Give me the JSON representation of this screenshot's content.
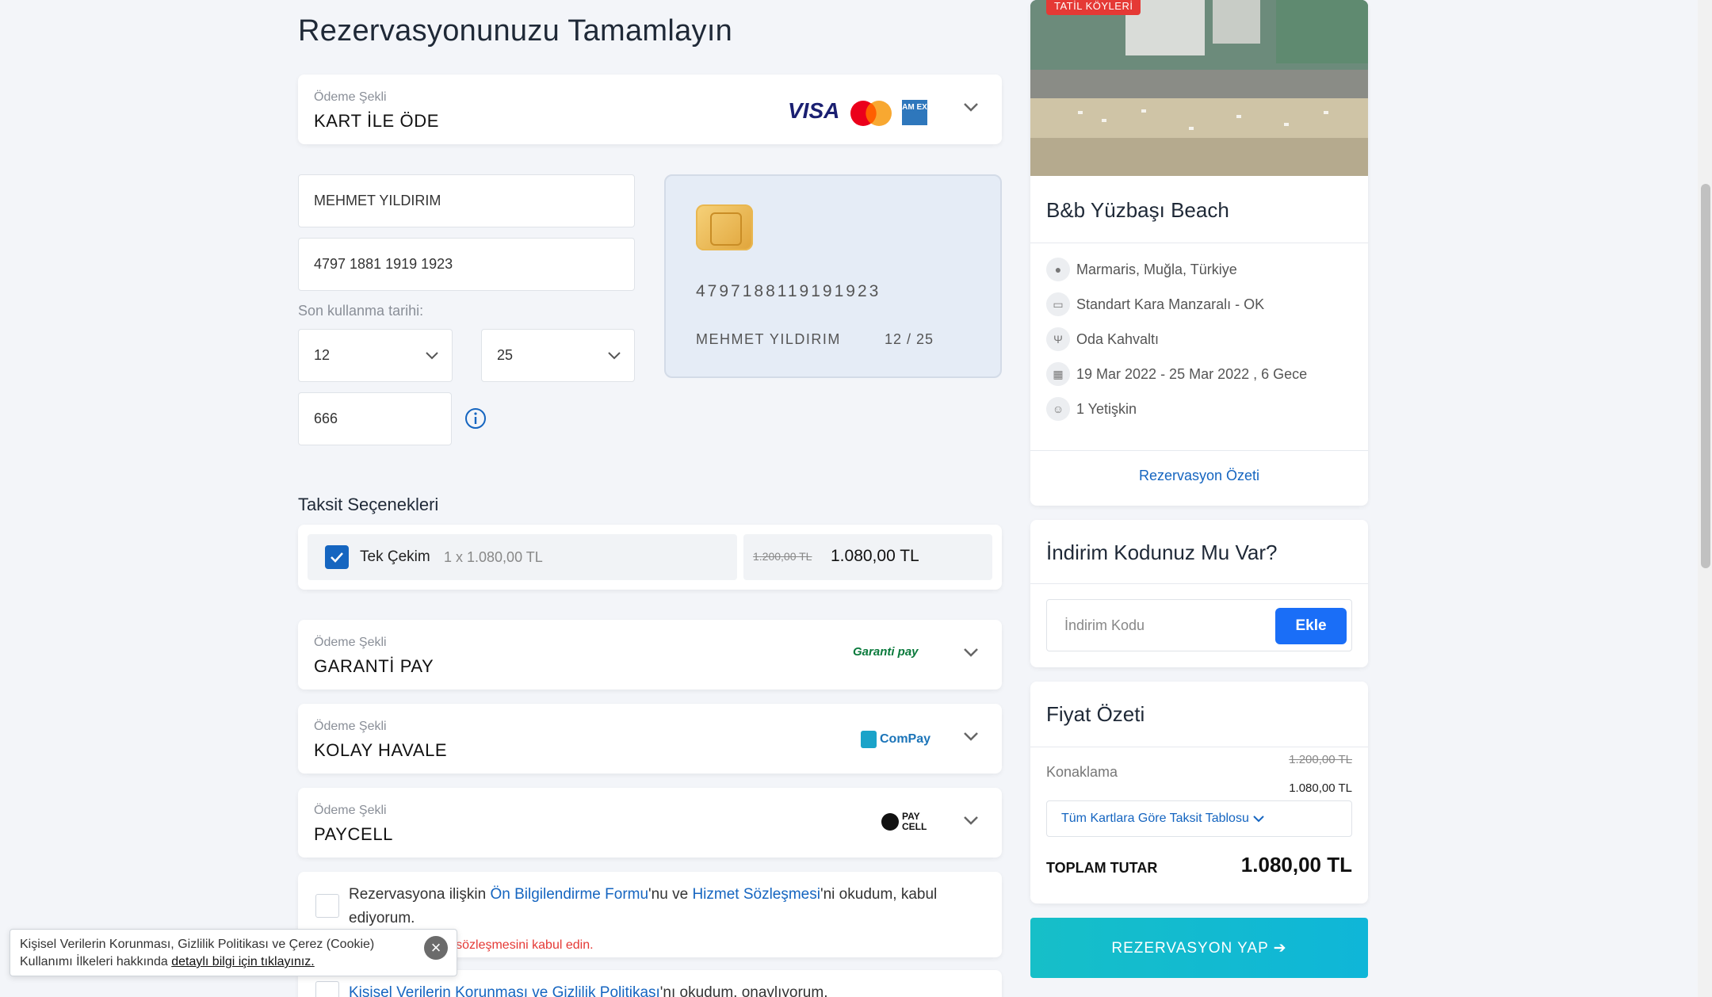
{
  "page": {
    "title": "Rezervasyonunuzu Tamamlayın"
  },
  "payment_card": {
    "label": "Ödeme Şekli",
    "value": "KART İLE ÖDE",
    "logos": [
      "visa-logo",
      "mastercard-logo",
      "amex-logo"
    ],
    "visa_text": "VISA",
    "amex_text": "AM EX"
  },
  "form": {
    "name": "MEHMET YILDIRIM",
    "card_number": "4797 1881 1919 1923",
    "expiry_label": "Son kullanma tarihi:",
    "month": "12",
    "year": "25",
    "cvv": "666"
  },
  "card_preview": {
    "number": "4797188119191923",
    "name": "MEHMET YILDIRIM",
    "expiry": "12 / 25"
  },
  "installments": {
    "title": "Taksit Seçenekleri",
    "option_name": "Tek Çekim",
    "option_detail": "1 x 1.080,00 TL",
    "old_price": "1.200,00 TL",
    "price": "1.080,00 TL"
  },
  "other_payments": [
    {
      "label": "Ödeme Şekli",
      "value": "GARANTİ PAY",
      "logo": "Garanti pay"
    },
    {
      "label": "Ödeme Şekli",
      "value": "KOLAY HAVALE",
      "logo": "ComPay"
    },
    {
      "label": "Ödeme Şekli",
      "value": "PAYCELL",
      "logo": "PAY CELL"
    }
  ],
  "terms": {
    "prefix": "Rezervasyona ilişkin ",
    "link1": "Ön Bilgilendirme Formu",
    "mid": "'nu ve ",
    "link2": "Hizmet Sözleşmesi",
    "suffix": "'ni okudum, kabul ediyorum.",
    "error": "zmet sözleşmesini kabul edin.",
    "second_link": "Kişisel Verilerin Korunması ve Gizlilik Politikası",
    "second_suffix": "'nı okudum, onaylıyorum."
  },
  "cookie": {
    "text": "Kişisel Verilerin Korunması, Gizlilik Politikası ve Çerez (Cookie) Kullanımı İlkeleri hakkında",
    "link": "detaylı bilgi için tıklayınız.",
    "close": "×"
  },
  "hotel": {
    "badge": "TATİL KÖYLERİ",
    "name": "B&b Yüzbaşı Beach",
    "location": "Marmaris, Muğla, Türkiye",
    "room": "Standart Kara Manzaralı - OK",
    "board": "Oda Kahvaltı",
    "dates": "19 Mar 2022 - 25 Mar 2022 , 6 Gece",
    "guests": "1 Yetişkin",
    "summary_link": "Rezervasyon Özeti"
  },
  "discount": {
    "title": "İndirim Kodunuz Mu Var?",
    "placeholder": "İndirim Kodu",
    "button": "Ekle"
  },
  "price_summary": {
    "title": "Fiyat Özeti",
    "accommodation_label": "Konaklama",
    "old_price": "1.200,00 TL",
    "price": "1.080,00 TL",
    "installment_table": "Tüm Kartlara Göre Taksit Tablosu",
    "total_label": "TOPLAM TUTAR",
    "total": "1.080,00 TL"
  },
  "book_button": "REZERVASYON YAP ➔",
  "colors": {
    "primary": "#1565c0",
    "accent_button": "#1a6ef7",
    "book_button": "#16bfc8",
    "error": "#e53935"
  }
}
